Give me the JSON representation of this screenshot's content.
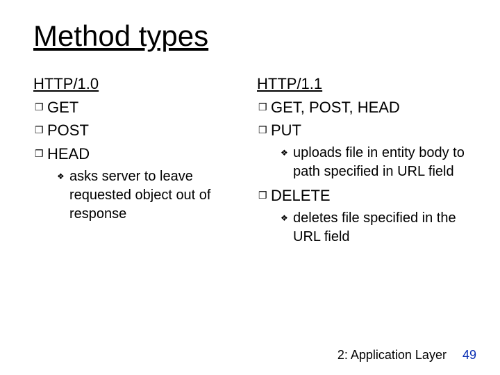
{
  "title": "Method types",
  "left": {
    "heading": "HTTP/1.0",
    "items": [
      {
        "label": "GET"
      },
      {
        "label": "POST"
      },
      {
        "label": "HEAD",
        "sub": [
          "asks server to leave requested object out of response"
        ]
      }
    ]
  },
  "right": {
    "heading": "HTTP/1.1",
    "items": [
      {
        "label": "GET, POST, HEAD"
      },
      {
        "label": "PUT",
        "sub": [
          "uploads file in entity body to path specified in URL field"
        ]
      },
      {
        "label": "DELETE",
        "sub": [
          "deletes file specified in the URL field"
        ]
      }
    ]
  },
  "footer": {
    "chapter": "2: Application Layer",
    "page": "49"
  },
  "bullets": {
    "level1": "❒",
    "level2": "❖"
  }
}
